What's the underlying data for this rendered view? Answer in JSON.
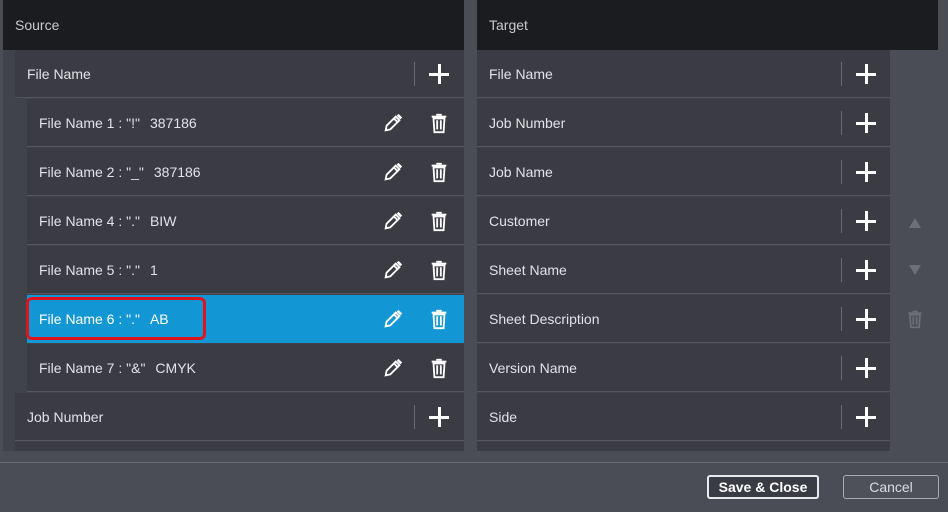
{
  "source": {
    "header": "Source",
    "groups": [
      {
        "label": "File Name",
        "children": [
          {
            "label": "File Name 1 : \"!\"",
            "value": "387186"
          },
          {
            "label": "File Name 2 : \"_\"",
            "value": "387186"
          },
          {
            "label": "File Name 4 : \".\"",
            "value": "BIW"
          },
          {
            "label": "File Name 5 : \".\"",
            "value": "1"
          },
          {
            "label": "File Name 6 : \".\"",
            "value": "AB",
            "selected": true
          },
          {
            "label": "File Name 7 : \"&\"",
            "value": "CMYK"
          }
        ]
      },
      {
        "label": "Job Number",
        "children": []
      }
    ]
  },
  "target": {
    "header": "Target",
    "items": [
      "File Name",
      "Job Number",
      "Job Name",
      "Customer",
      "Sheet Name",
      "Sheet Description",
      "Version Name",
      "Side"
    ]
  },
  "side_tools": [
    "move-up-icon",
    "move-down-icon",
    "trash-icon"
  ],
  "buttons": {
    "save_close": "Save & Close",
    "cancel": "Cancel"
  },
  "colors": {
    "selected": "#1396d4",
    "highlight": "#e0141e",
    "header": "#1b1c20"
  }
}
